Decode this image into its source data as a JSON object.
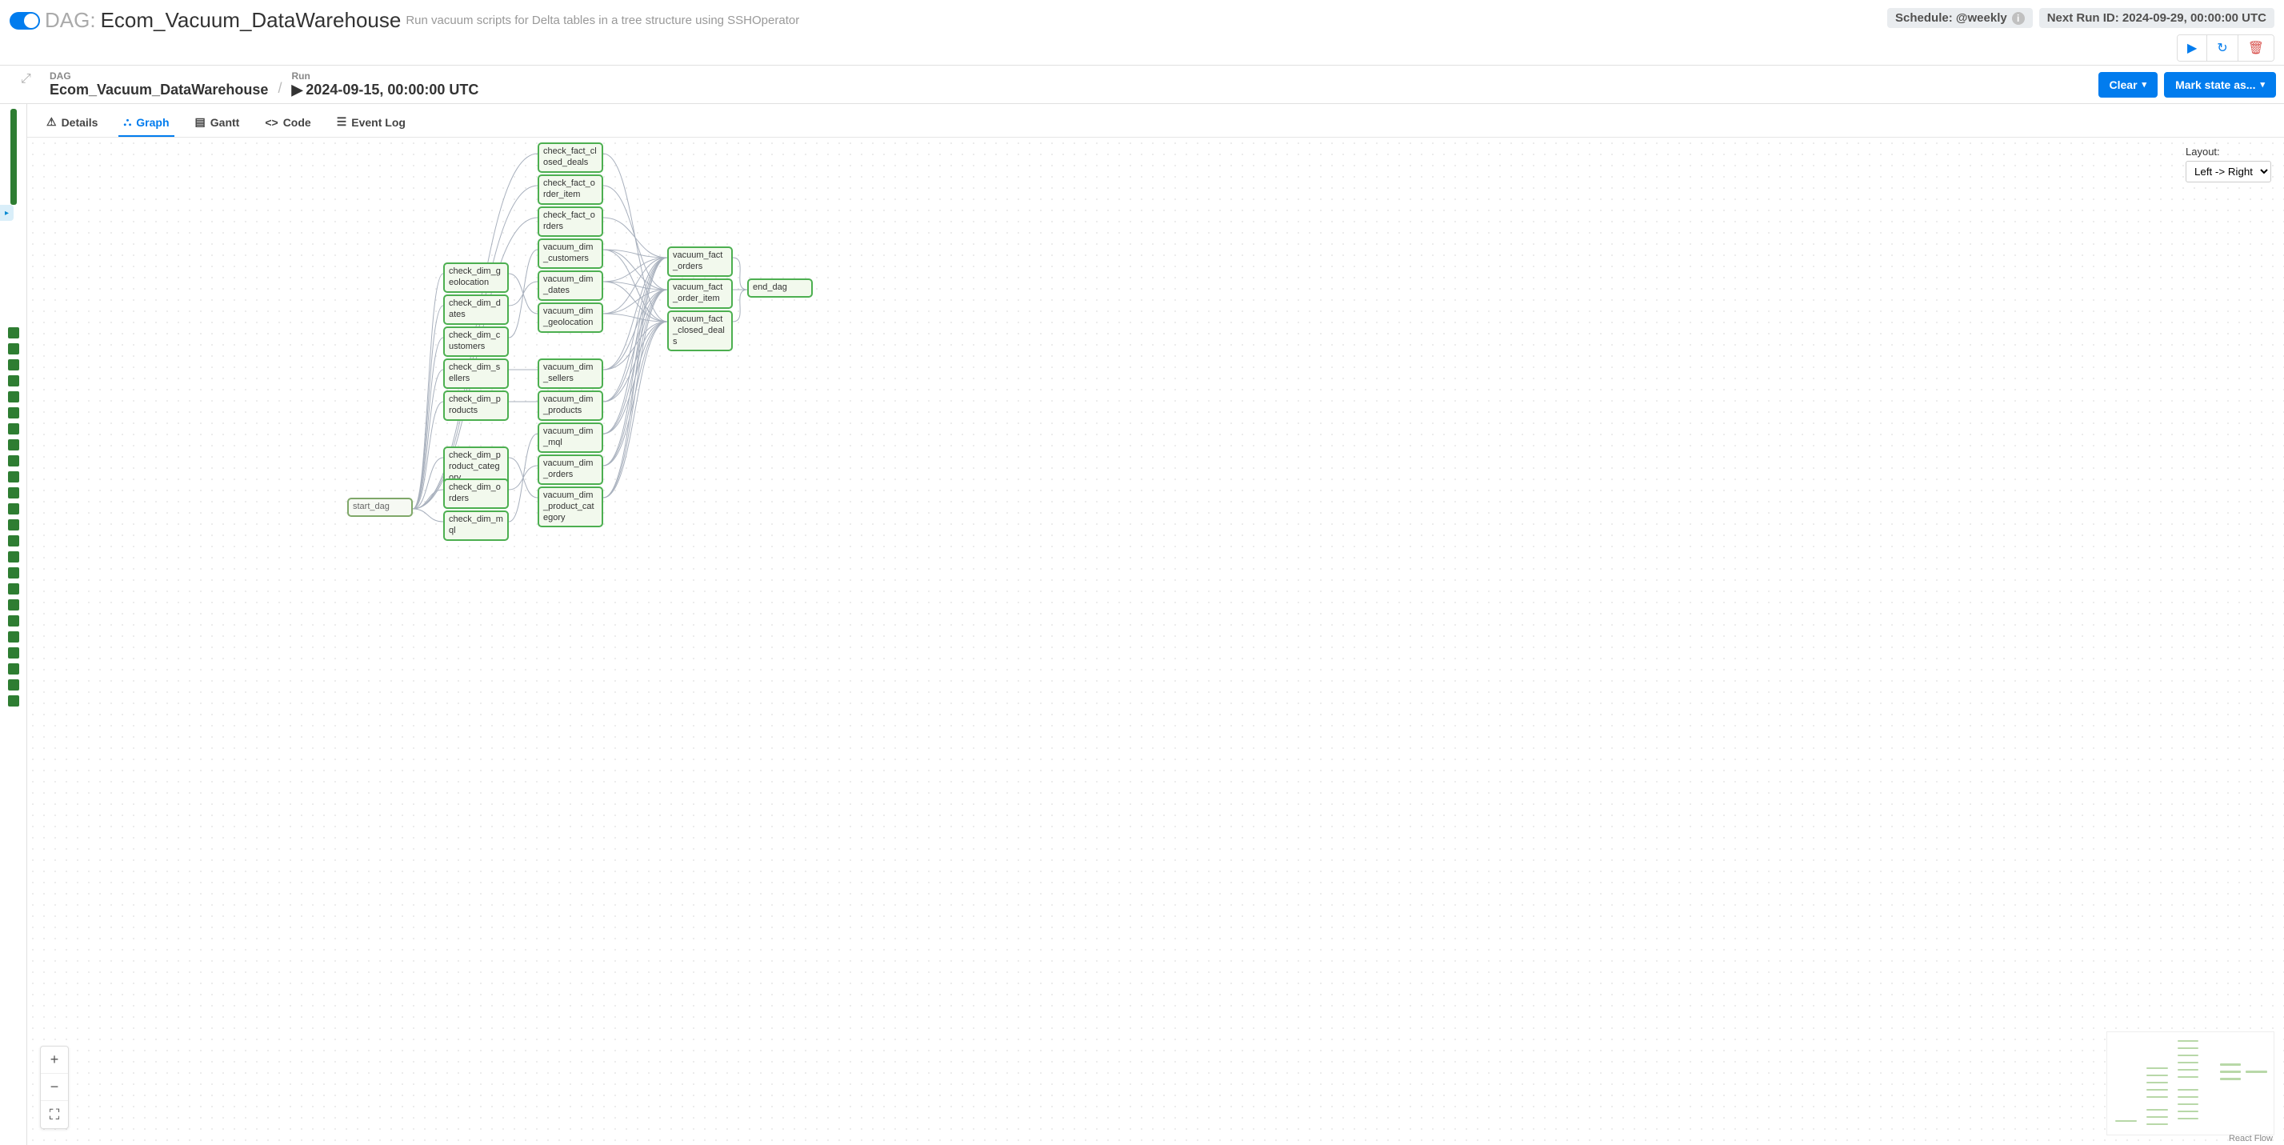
{
  "header": {
    "dag_label": "DAG:",
    "dag_name": "Ecom_Vacuum_DataWarehouse",
    "description": "Run vacuum scripts for Delta tables in a tree structure using SSHOperator",
    "schedule_badge": "Schedule: @weekly",
    "next_run_badge": "Next Run ID: 2024-09-29, 00:00:00 UTC"
  },
  "crumbs": {
    "dag_label": "DAG",
    "dag_value": "Ecom_Vacuum_DataWarehouse",
    "run_label": "Run",
    "run_value": "2024-09-15, 00:00:00 UTC"
  },
  "actions": {
    "clear": "Clear",
    "mark_state": "Mark state as..."
  },
  "tabs": {
    "details": "Details",
    "graph": "Graph",
    "gantt": "Gantt",
    "code": "Code",
    "event_log": "Event Log"
  },
  "layout": {
    "label": "Layout:",
    "selected": "Left -> Right"
  },
  "reactflow": "React Flow",
  "nodes": {
    "start_dag": "start_dag",
    "check_dim_geolocation": "check_dim_geolocation",
    "check_dim_dates": "check_dim_dates",
    "check_dim_customers": "check_dim_customers",
    "check_dim_sellers": "check_dim_sellers",
    "check_dim_products": "check_dim_products",
    "check_dim_product_category": "check_dim_product_category",
    "check_dim_orders": "check_dim_orders",
    "check_dim_mql": "check_dim_mql",
    "check_fact_closed_deals": "check_fact_closed_deals",
    "check_fact_order_item": "check_fact_order_item",
    "check_fact_orders": "check_fact_orders",
    "vacuum_dim_customers": "vacuum_dim_customers",
    "vacuum_dim_dates": "vacuum_dim_dates",
    "vacuum_dim_geolocation": "vacuum_dim_geolocation",
    "vacuum_dim_sellers": "vacuum_dim_sellers",
    "vacuum_dim_products": "vacuum_dim_products",
    "vacuum_dim_mql": "vacuum_dim_mql",
    "vacuum_dim_orders": "vacuum_dim_orders",
    "vacuum_dim_product_category": "vacuum_dim_product_category",
    "vacuum_fact_orders": "vacuum_fact_orders",
    "vacuum_fact_order_item": "vacuum_fact_order_item",
    "vacuum_fact_closed_deals": "vacuum_fact_closed_deals",
    "end_dag": "end_dag"
  },
  "task_squares_count": 24,
  "chart_data": {
    "type": "dag_graph",
    "layout": "Left -> Right",
    "nodes": [
      {
        "id": "start_dag",
        "col": 0
      },
      {
        "id": "check_dim_geolocation",
        "col": 1
      },
      {
        "id": "check_dim_dates",
        "col": 1
      },
      {
        "id": "check_dim_customers",
        "col": 1
      },
      {
        "id": "check_dim_sellers",
        "col": 1
      },
      {
        "id": "check_dim_products",
        "col": 1
      },
      {
        "id": "check_dim_product_category",
        "col": 1
      },
      {
        "id": "check_dim_orders",
        "col": 1
      },
      {
        "id": "check_dim_mql",
        "col": 1
      },
      {
        "id": "check_fact_closed_deals",
        "col": 2
      },
      {
        "id": "check_fact_order_item",
        "col": 2
      },
      {
        "id": "check_fact_orders",
        "col": 2
      },
      {
        "id": "vacuum_dim_customers",
        "col": 2
      },
      {
        "id": "vacuum_dim_dates",
        "col": 2
      },
      {
        "id": "vacuum_dim_geolocation",
        "col": 2
      },
      {
        "id": "vacuum_dim_sellers",
        "col": 2
      },
      {
        "id": "vacuum_dim_products",
        "col": 2
      },
      {
        "id": "vacuum_dim_mql",
        "col": 2
      },
      {
        "id": "vacuum_dim_orders",
        "col": 2
      },
      {
        "id": "vacuum_dim_product_category",
        "col": 2
      },
      {
        "id": "vacuum_fact_orders",
        "col": 3
      },
      {
        "id": "vacuum_fact_order_item",
        "col": 3
      },
      {
        "id": "vacuum_fact_closed_deals",
        "col": 3
      },
      {
        "id": "end_dag",
        "col": 4
      }
    ],
    "edges": [
      [
        "start_dag",
        "check_dim_geolocation"
      ],
      [
        "start_dag",
        "check_dim_dates"
      ],
      [
        "start_dag",
        "check_dim_customers"
      ],
      [
        "start_dag",
        "check_dim_sellers"
      ],
      [
        "start_dag",
        "check_dim_products"
      ],
      [
        "start_dag",
        "check_dim_product_category"
      ],
      [
        "start_dag",
        "check_dim_orders"
      ],
      [
        "start_dag",
        "check_dim_mql"
      ],
      [
        "start_dag",
        "check_fact_closed_deals"
      ],
      [
        "start_dag",
        "check_fact_order_item"
      ],
      [
        "start_dag",
        "check_fact_orders"
      ],
      [
        "check_dim_geolocation",
        "vacuum_dim_geolocation"
      ],
      [
        "check_dim_dates",
        "vacuum_dim_dates"
      ],
      [
        "check_dim_customers",
        "vacuum_dim_customers"
      ],
      [
        "check_dim_sellers",
        "vacuum_dim_sellers"
      ],
      [
        "check_dim_products",
        "vacuum_dim_products"
      ],
      [
        "check_dim_product_category",
        "vacuum_dim_product_category"
      ],
      [
        "check_dim_orders",
        "vacuum_dim_orders"
      ],
      [
        "check_dim_mql",
        "vacuum_dim_mql"
      ],
      [
        "check_fact_orders",
        "vacuum_fact_orders"
      ],
      [
        "check_fact_order_item",
        "vacuum_fact_order_item"
      ],
      [
        "check_fact_closed_deals",
        "vacuum_fact_closed_deals"
      ],
      [
        "vacuum_dim_customers",
        "vacuum_fact_orders"
      ],
      [
        "vacuum_dim_customers",
        "vacuum_fact_order_item"
      ],
      [
        "vacuum_dim_customers",
        "vacuum_fact_closed_deals"
      ],
      [
        "vacuum_dim_dates",
        "vacuum_fact_orders"
      ],
      [
        "vacuum_dim_dates",
        "vacuum_fact_order_item"
      ],
      [
        "vacuum_dim_dates",
        "vacuum_fact_closed_deals"
      ],
      [
        "vacuum_dim_geolocation",
        "vacuum_fact_orders"
      ],
      [
        "vacuum_dim_geolocation",
        "vacuum_fact_order_item"
      ],
      [
        "vacuum_dim_geolocation",
        "vacuum_fact_closed_deals"
      ],
      [
        "vacuum_dim_sellers",
        "vacuum_fact_orders"
      ],
      [
        "vacuum_dim_sellers",
        "vacuum_fact_order_item"
      ],
      [
        "vacuum_dim_sellers",
        "vacuum_fact_closed_deals"
      ],
      [
        "vacuum_dim_products",
        "vacuum_fact_orders"
      ],
      [
        "vacuum_dim_products",
        "vacuum_fact_order_item"
      ],
      [
        "vacuum_dim_products",
        "vacuum_fact_closed_deals"
      ],
      [
        "vacuum_dim_mql",
        "vacuum_fact_orders"
      ],
      [
        "vacuum_dim_mql",
        "vacuum_fact_order_item"
      ],
      [
        "vacuum_dim_mql",
        "vacuum_fact_closed_deals"
      ],
      [
        "vacuum_dim_orders",
        "vacuum_fact_orders"
      ],
      [
        "vacuum_dim_orders",
        "vacuum_fact_order_item"
      ],
      [
        "vacuum_dim_orders",
        "vacuum_fact_closed_deals"
      ],
      [
        "vacuum_dim_product_category",
        "vacuum_fact_orders"
      ],
      [
        "vacuum_dim_product_category",
        "vacuum_fact_order_item"
      ],
      [
        "vacuum_dim_product_category",
        "vacuum_fact_closed_deals"
      ],
      [
        "vacuum_fact_orders",
        "end_dag"
      ],
      [
        "vacuum_fact_order_item",
        "end_dag"
      ],
      [
        "vacuum_fact_closed_deals",
        "end_dag"
      ]
    ]
  }
}
